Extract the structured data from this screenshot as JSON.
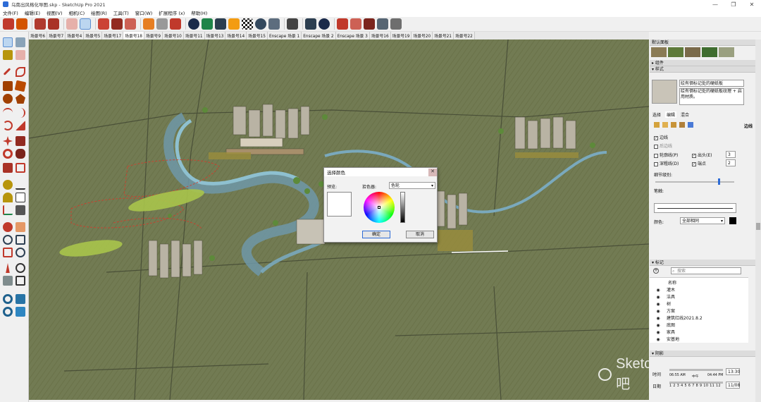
{
  "window": {
    "title": "乌南出风格化导图.skp - SketchUp Pro 2021"
  },
  "menu": [
    "文件(F)",
    "编辑(E)",
    "视图(V)",
    "相机(C)",
    "绘图(R)",
    "工具(T)",
    "窗口(W)",
    "扩展程序 (x)",
    "帮助(H)"
  ],
  "scene_tabs": [
    "场景号6",
    "场景号7",
    "场景号4",
    "场景号5",
    "场景号17",
    "场景号18",
    "场景号9",
    "场景号10",
    "场景号11",
    "场景号13",
    "场景号14",
    "场景号15",
    "Enscape 场景 1",
    "Enscape 场景 2",
    "Enscape 场景 3",
    "场景号16",
    "场景号19",
    "场景号20",
    "场景号21",
    "场景号22"
  ],
  "active_scene": "场景号18",
  "dialog": {
    "title": "选择颜色",
    "preview_label": "预览:",
    "picker_label": "拾色器:",
    "picker_value": "色轮",
    "ok": "确定",
    "cancel": "取消"
  },
  "tray": {
    "default_panel": "默认面板",
    "components": "组件",
    "styles": "样式",
    "style_name": "绘有徊标记处的硬纸板",
    "style_desc": "绘有徊标记处的硬纸板纹理 + 启用材质。",
    "style_tabs": [
      "选择",
      "编辑",
      "混合"
    ],
    "edges_title": "边线",
    "cb_edges": "边线",
    "cb_back_edges": "后边线",
    "cb_profiles": "轮廓线(P)",
    "cb_depth": "深粗线(D)",
    "cb_extension": "出头(E)",
    "cb_endpoints": "端点",
    "ext_val": "3",
    "end_val": "2",
    "level_of_detail": "细节级别:",
    "jitter": "笔触:",
    "color_label": "颜色:",
    "color_value": "全部相同",
    "tags": "标记",
    "search_placeholder": "搜索",
    "name_col": "名称",
    "tag_list": [
      "灌木",
      "洁具",
      "树",
      "方案",
      "建筑红线2021.8.2",
      "底图",
      "家具",
      "安基地"
    ],
    "shadows": "阴影",
    "time_label": "时间",
    "time_start": "06:55 AM",
    "time_mid": "中午",
    "time_end": "04:44 PM",
    "time_val": "13:30",
    "date_label": "日期",
    "months": "1 2 3 4 5 6 7 8 9 10 11 12",
    "date_val": "11/08"
  },
  "watermark": "SketchUp吧",
  "colors": {
    "accent": "#2d6bd6",
    "ground": "#727b53",
    "water": "#7aa9bd",
    "red": "#d63a2a"
  }
}
